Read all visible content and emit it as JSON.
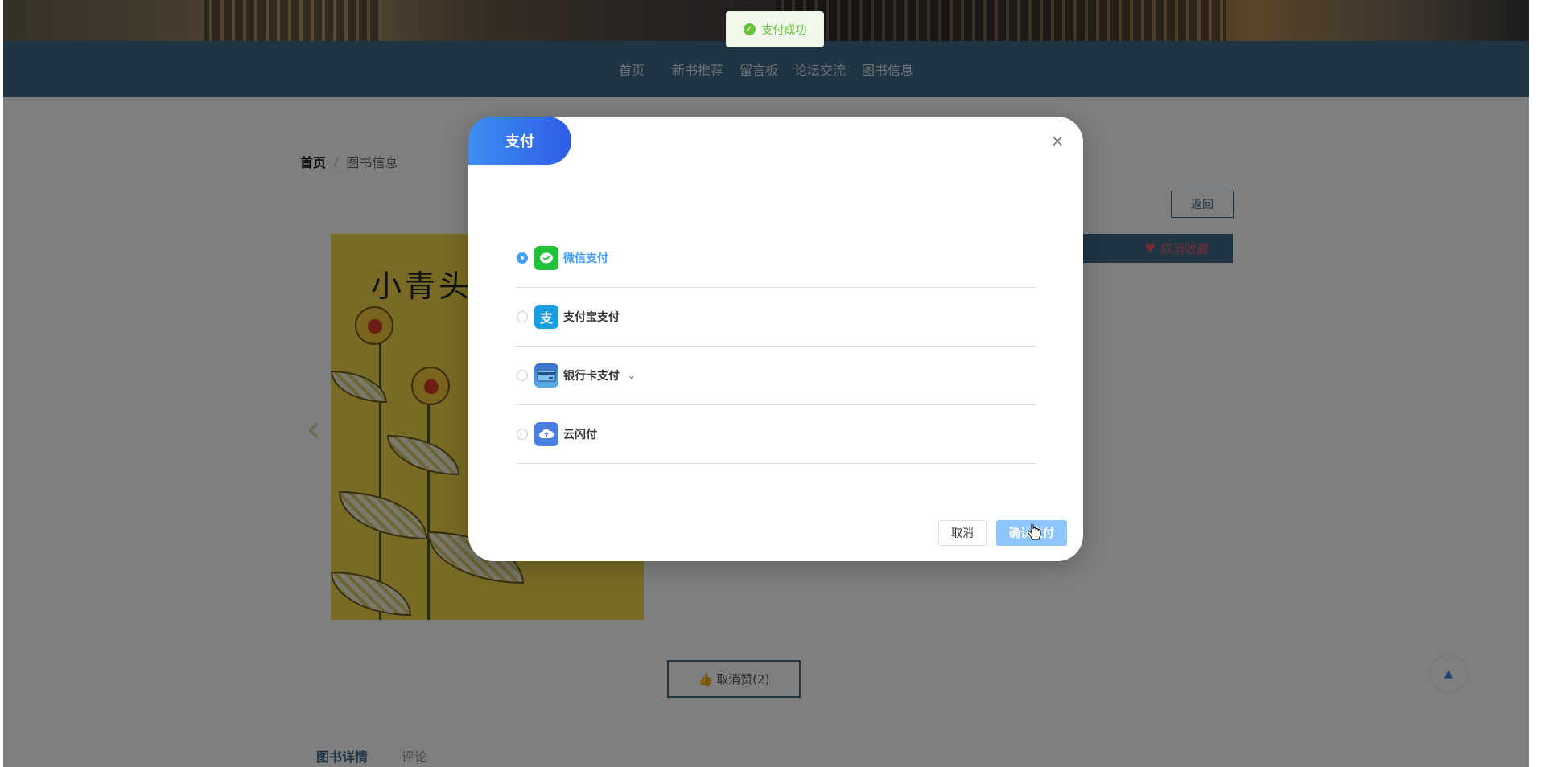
{
  "nav": {
    "items": [
      "首页",
      "新书推荐",
      "留言板",
      "论坛交流",
      "图书信息"
    ]
  },
  "breadcrumb": {
    "home": "首页",
    "separator": "/",
    "current": "图书信息"
  },
  "actions": {
    "back": "返回",
    "favorite": "取消收藏",
    "like": "取消赞(2)",
    "top_icon": "caret-up-icon"
  },
  "book": {
    "cover_title": "小青头"
  },
  "tabs": [
    "图书详情",
    "评论"
  ],
  "toast": {
    "message": "支付成功",
    "icon": "check-circle-icon",
    "color": "#67c23a"
  },
  "dialog": {
    "title": "支付",
    "methods": [
      {
        "label": "微信支付",
        "icon": "wechat-icon",
        "selected": true
      },
      {
        "label": "支付宝支付",
        "icon": "alipay-icon",
        "selected": false
      },
      {
        "label": "银行卡支付",
        "icon": "bank-card-icon",
        "selected": false
      },
      {
        "label": "云闪付",
        "icon": "unionpay-cloud-icon",
        "selected": false
      }
    ],
    "cancel": "取消",
    "confirm": "确认支付"
  },
  "colors": {
    "nav_bg": "#3e6a88",
    "accent": "#409eff",
    "title_gradient_start": "#3d8ff0",
    "title_gradient_end": "#2f5ce6"
  }
}
